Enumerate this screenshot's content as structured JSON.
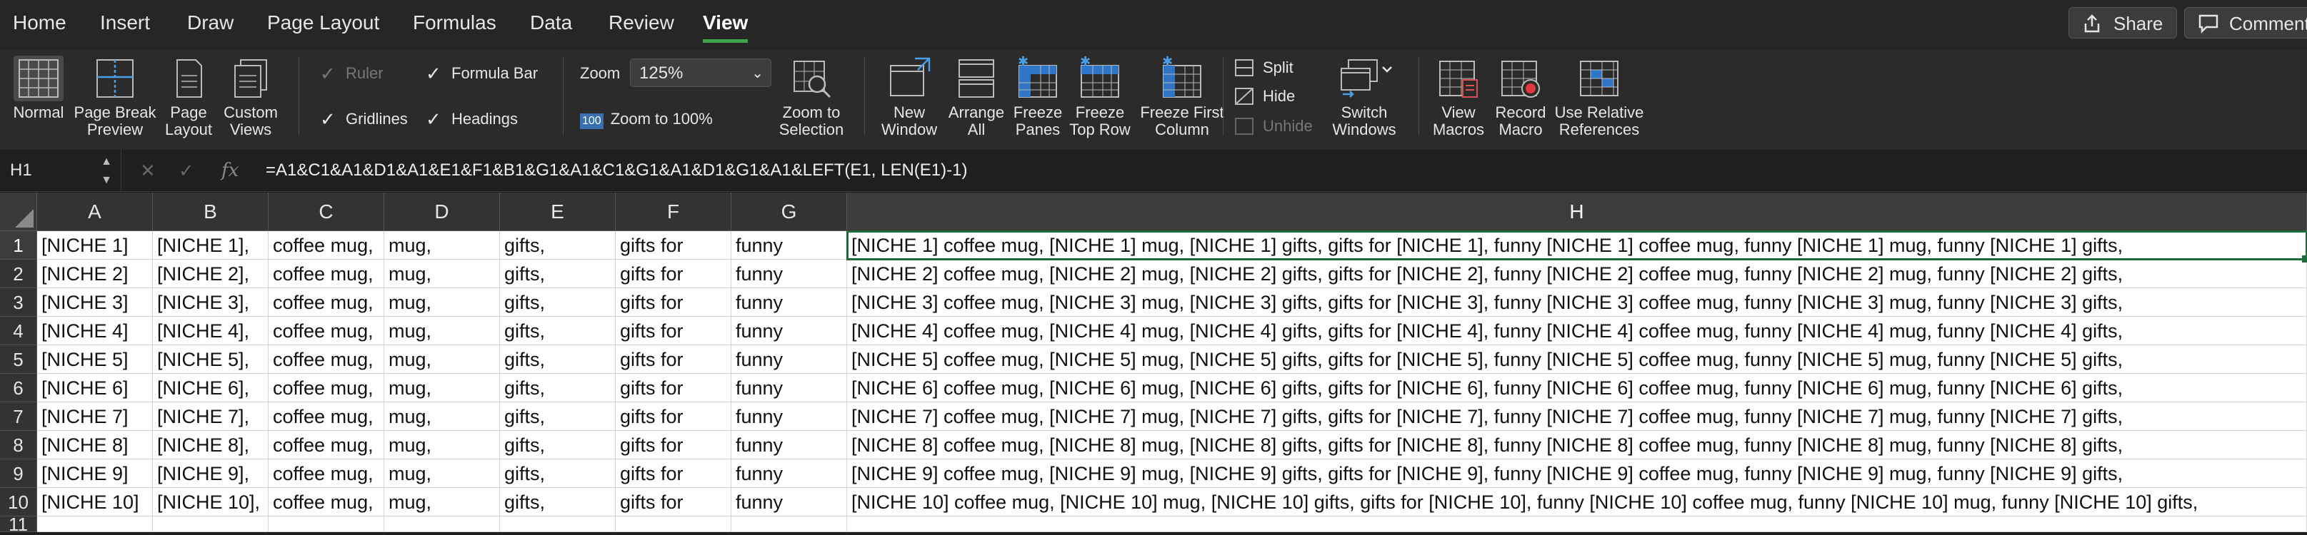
{
  "menu": {
    "tabs": [
      "Home",
      "Insert",
      "Draw",
      "Page Layout",
      "Formulas",
      "Data",
      "Review",
      "View"
    ],
    "active_tab": "View",
    "share_label": "Share",
    "comments_label": "Comments"
  },
  "ribbon": {
    "normal": "Normal",
    "page_break_1": "Page Break",
    "page_break_2": "Preview",
    "page_layout_1": "Page",
    "page_layout_2": "Layout",
    "custom_views_1": "Custom",
    "custom_views_2": "Views",
    "ruler": "Ruler",
    "formula_bar": "Formula Bar",
    "gridlines": "Gridlines",
    "headings": "Headings",
    "zoom_label": "Zoom",
    "zoom_value": "125%",
    "zoom_100_badge": "100",
    "zoom_100": "Zoom to 100%",
    "zoom_sel_1": "Zoom to",
    "zoom_sel_2": "Selection",
    "new_window_1": "New",
    "new_window_2": "Window",
    "arrange_all_1": "Arrange",
    "arrange_all_2": "All",
    "freeze_panes_1": "Freeze",
    "freeze_panes_2": "Panes",
    "freeze_top_row_1": "Freeze",
    "freeze_top_row_2": "Top Row",
    "freeze_first_col_1": "Freeze First",
    "freeze_first_col_2": "Column",
    "split": "Split",
    "hide": "Hide",
    "unhide": "Unhide",
    "switch_windows_1": "Switch",
    "switch_windows_2": "Windows",
    "view_macros_1": "View",
    "view_macros_2": "Macros",
    "record_macro_1": "Record",
    "record_macro_2": "Macro",
    "use_relative_1": "Use Relative",
    "use_relative_2": "References"
  },
  "formula_bar": {
    "name_box": "H1",
    "fx": "fx",
    "formula": "=A1&C1&A1&D1&A1&E1&F1&B1&G1&A1&C1&G1&A1&D1&G1&A1&LEFT(E1, LEN(E1)-1)"
  },
  "sheet": {
    "columns": [
      "A",
      "B",
      "C",
      "D",
      "E",
      "F",
      "G",
      "H"
    ],
    "selected_cell": "H1",
    "rows": [
      {
        "n": "1",
        "cells": [
          "[NICHE 1]",
          "[NICHE 1],",
          "coffee mug,",
          "mug,",
          "gifts,",
          "gifts for",
          "funny",
          "[NICHE 1] coffee mug, [NICHE 1] mug, [NICHE 1] gifts,  gifts for [NICHE 1],  funny [NICHE 1] coffee mug,  funny [NICHE 1] mug,  funny [NICHE 1] gifts,"
        ]
      },
      {
        "n": "2",
        "cells": [
          "[NICHE 2]",
          "[NICHE 2],",
          "coffee mug,",
          "mug,",
          "gifts,",
          "gifts for",
          "funny",
          "[NICHE 2] coffee mug, [NICHE 2] mug, [NICHE 2] gifts,  gifts for [NICHE 2],  funny [NICHE 2] coffee mug,  funny [NICHE 2] mug,  funny [NICHE 2] gifts,"
        ]
      },
      {
        "n": "3",
        "cells": [
          "[NICHE 3]",
          "[NICHE 3],",
          "coffee mug,",
          "mug,",
          "gifts,",
          "gifts for",
          "funny",
          "[NICHE 3] coffee mug, [NICHE 3] mug, [NICHE 3] gifts,  gifts for [NICHE 3],  funny [NICHE 3] coffee mug,  funny [NICHE 3] mug,  funny [NICHE 3] gifts,"
        ]
      },
      {
        "n": "4",
        "cells": [
          "[NICHE 4]",
          "[NICHE 4],",
          "coffee mug,",
          "mug,",
          "gifts,",
          "gifts for",
          "funny",
          "[NICHE 4] coffee mug, [NICHE 4] mug, [NICHE 4] gifts,  gifts for [NICHE 4],  funny [NICHE 4] coffee mug,  funny [NICHE 4] mug,  funny [NICHE 4] gifts,"
        ]
      },
      {
        "n": "5",
        "cells": [
          "[NICHE 5]",
          "[NICHE 5],",
          "coffee mug,",
          "mug,",
          "gifts,",
          "gifts for",
          "funny",
          "[NICHE 5] coffee mug, [NICHE 5] mug, [NICHE 5] gifts,  gifts for [NICHE 5],  funny [NICHE 5] coffee mug,  funny [NICHE 5] mug,  funny [NICHE 5] gifts,"
        ]
      },
      {
        "n": "6",
        "cells": [
          "[NICHE 6]",
          "[NICHE 6],",
          "coffee mug,",
          "mug,",
          "gifts,",
          "gifts for",
          "funny",
          "[NICHE 6] coffee mug, [NICHE 6] mug, [NICHE 6] gifts,  gifts for [NICHE 6],  funny [NICHE 6] coffee mug,  funny [NICHE 6] mug,  funny [NICHE 6] gifts,"
        ]
      },
      {
        "n": "7",
        "cells": [
          "[NICHE 7]",
          "[NICHE 7],",
          "coffee mug,",
          "mug,",
          "gifts,",
          "gifts for",
          "funny",
          "[NICHE 7] coffee mug, [NICHE 7] mug, [NICHE 7] gifts,  gifts for [NICHE 7],  funny [NICHE 7] coffee mug,  funny [NICHE 7] mug,  funny [NICHE 7] gifts,"
        ]
      },
      {
        "n": "8",
        "cells": [
          "[NICHE 8]",
          "[NICHE 8],",
          "coffee mug,",
          "mug,",
          "gifts,",
          "gifts for",
          "funny",
          "[NICHE 8] coffee mug, [NICHE 8] mug, [NICHE 8] gifts,  gifts for [NICHE 8],  funny [NICHE 8] coffee mug,  funny [NICHE 8] mug,  funny [NICHE 8] gifts,"
        ]
      },
      {
        "n": "9",
        "cells": [
          "[NICHE 9]",
          "[NICHE 9],",
          "coffee mug,",
          "mug,",
          "gifts,",
          "gifts for",
          "funny",
          "[NICHE 9] coffee mug, [NICHE 9] mug, [NICHE 9] gifts,  gifts for [NICHE 9],  funny [NICHE 9] coffee mug,  funny [NICHE 9] mug,  funny [NICHE 9] gifts,"
        ]
      },
      {
        "n": "10",
        "cells": [
          "[NICHE 10]",
          "[NICHE 10],",
          "coffee mug,",
          "mug,",
          "gifts,",
          "gifts for",
          "funny",
          "[NICHE 10] coffee mug, [NICHE 10] mug, [NICHE 10] gifts,  gifts for [NICHE 10],  funny [NICHE 10] coffee mug,  funny [NICHE 10] mug,  funny [NICHE 10] gifts,"
        ]
      },
      {
        "n": "11",
        "cells": [
          "",
          "",
          "",
          "",
          "",
          "",
          "",
          ""
        ]
      }
    ]
  }
}
